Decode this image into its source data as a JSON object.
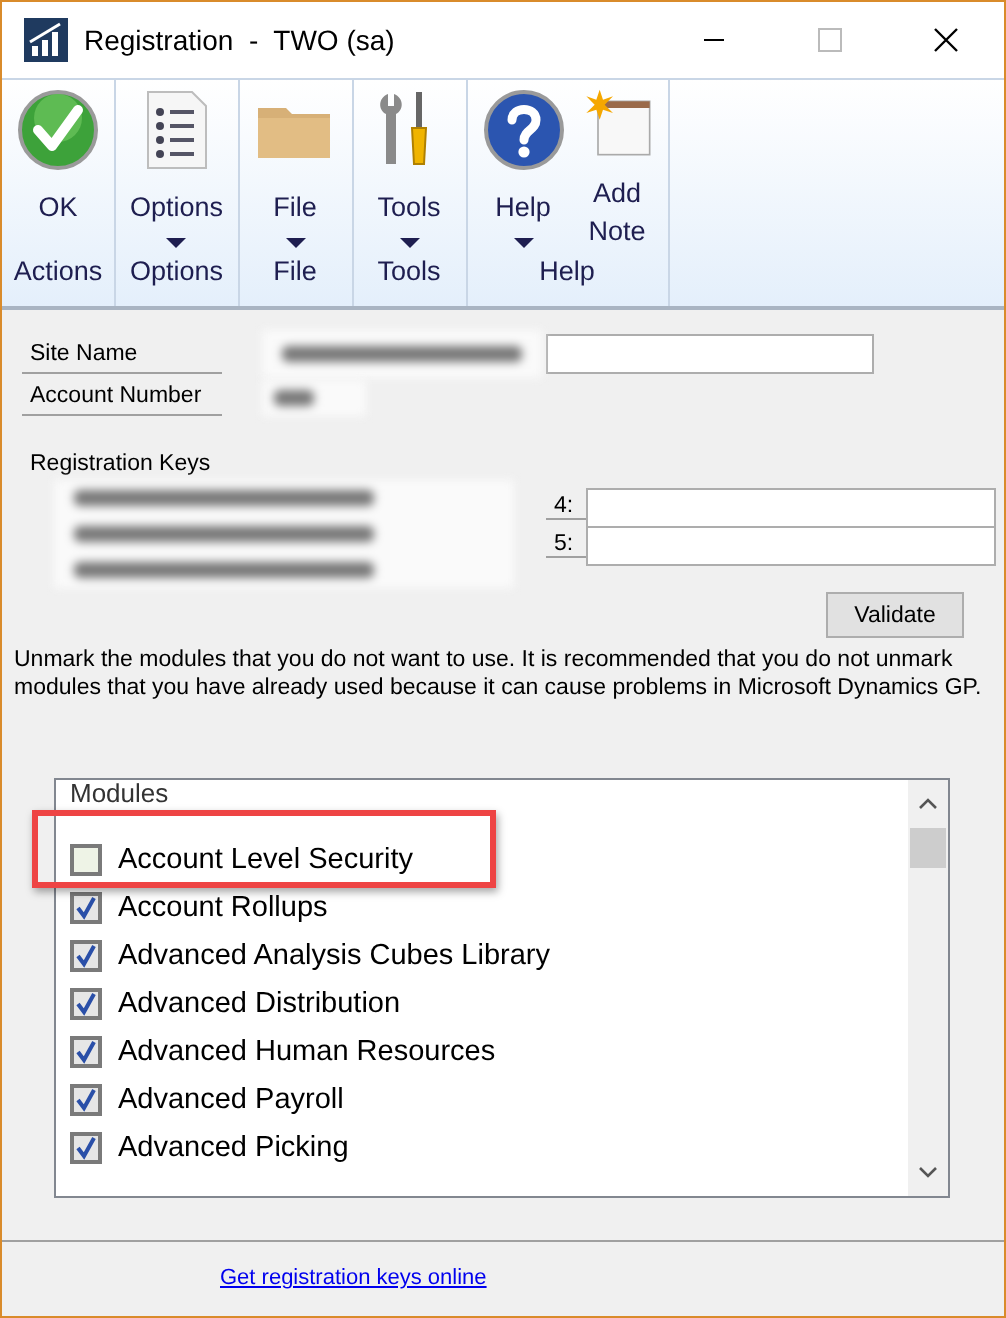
{
  "window": {
    "title": "Registration  -  TWO (sa)"
  },
  "ribbon": {
    "groups": [
      {
        "label": "Actions",
        "buttons": [
          {
            "label": "OK",
            "kind": "ok",
            "dropdown": false
          }
        ]
      },
      {
        "label": "Options",
        "buttons": [
          {
            "label": "Options",
            "kind": "list",
            "dropdown": true
          }
        ]
      },
      {
        "label": "File",
        "buttons": [
          {
            "label": "File",
            "kind": "folder",
            "dropdown": true
          }
        ]
      },
      {
        "label": "Tools",
        "buttons": [
          {
            "label": "Tools",
            "kind": "tools",
            "dropdown": true
          }
        ]
      },
      {
        "label": "Help",
        "buttons": [
          {
            "label": "Help",
            "kind": "help",
            "dropdown": true
          },
          {
            "label": "Add Note",
            "kind": "note",
            "dropdown": false
          }
        ]
      }
    ]
  },
  "form": {
    "site_name_label": "Site Name",
    "account_number_label": "Account Number",
    "registration_keys_label": "Registration Keys",
    "key_fields": [
      {
        "label": "4:"
      },
      {
        "label": "5:"
      }
    ],
    "validate_button": {
      "label": "Validate"
    },
    "instructions": "Unmark the modules that you do not want to use. It is recommended that you do not unmark modules that you have already used because it can cause problems in Microsoft Dynamics GP."
  },
  "modules": {
    "header": "Modules",
    "items": [
      {
        "label": "Account Level Security",
        "checked": false
      },
      {
        "label": "Account Rollups",
        "checked": true
      },
      {
        "label": "Advanced Analysis Cubes Library",
        "checked": true
      },
      {
        "label": "Advanced Distribution",
        "checked": true
      },
      {
        "label": "Advanced Human Resources",
        "checked": true
      },
      {
        "label": "Advanced Payroll",
        "checked": true
      },
      {
        "label": "Advanced Picking",
        "checked": true
      }
    ]
  },
  "link": "Get registration keys online"
}
